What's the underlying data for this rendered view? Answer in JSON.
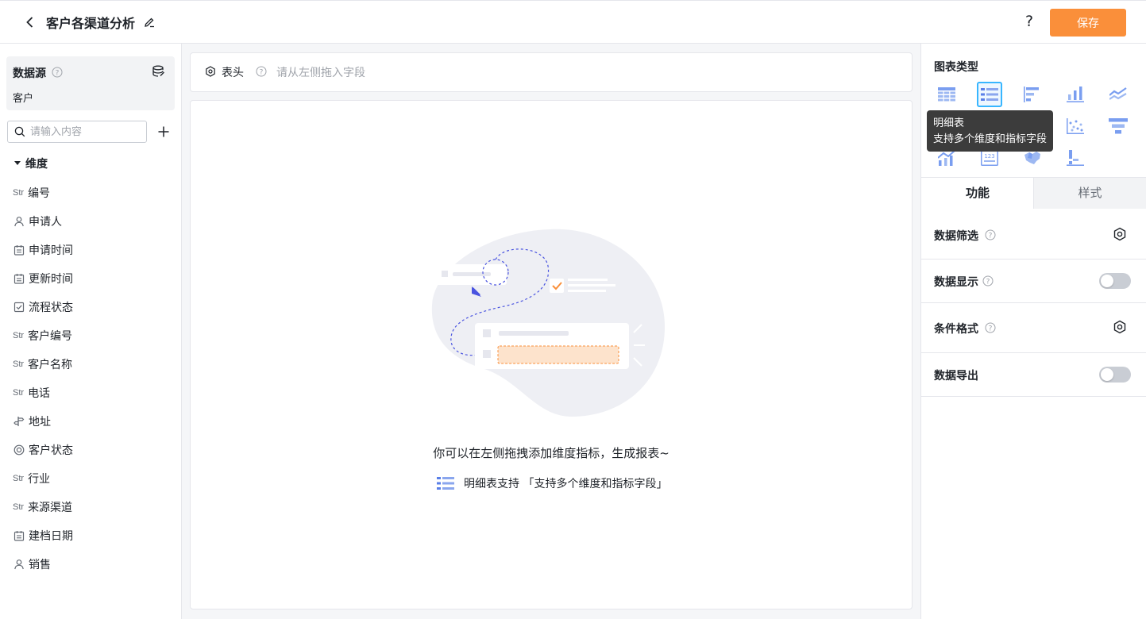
{
  "topbar": {
    "title": "客户各渠道分析",
    "help": "?",
    "save_label": "保存"
  },
  "left": {
    "datasource_label": "数据源",
    "datasource_value": "客户",
    "search_placeholder": "请输入内容",
    "dimension_header": "维度",
    "fields": [
      {
        "type": "text",
        "label": "编号"
      },
      {
        "type": "user",
        "label": "申请人"
      },
      {
        "type": "date",
        "label": "申请时间"
      },
      {
        "type": "date",
        "label": "更新时间"
      },
      {
        "type": "check",
        "label": "流程状态"
      },
      {
        "type": "text",
        "label": "客户编号"
      },
      {
        "type": "text",
        "label": "客户名称"
      },
      {
        "type": "text",
        "label": "电话"
      },
      {
        "type": "address",
        "label": "地址"
      },
      {
        "type": "radio",
        "label": "客户状态"
      },
      {
        "type": "text",
        "label": "行业"
      },
      {
        "type": "text",
        "label": "来源渠道"
      },
      {
        "type": "date",
        "label": "建档日期"
      },
      {
        "type": "user",
        "label": "销售"
      }
    ],
    "text_type_label": "Str"
  },
  "center": {
    "header_label": "表头",
    "header_placeholder": "请从左侧拖入字段",
    "empty_main": "你可以在左侧拖拽添加维度指标，生成报表~",
    "empty_sub": "明细表支持 「支持多个维度和指标字段」"
  },
  "right": {
    "chart_type_title": "图表类型",
    "tooltip_title": "明细表",
    "tooltip_desc": "支持多个维度和指标字段",
    "chart_type_names": [
      "table",
      "detail-table",
      "bar-horizontal",
      "bar-vertical",
      "line",
      "area",
      "pie",
      "donut",
      "scatter",
      "funnel",
      "combo",
      "number",
      "map",
      "waterfall"
    ],
    "tabs": {
      "function": "功能",
      "style": "样式"
    },
    "options": [
      {
        "label": "数据筛选",
        "control": "gear"
      },
      {
        "label": "数据显示",
        "control": "toggle",
        "on": false
      },
      {
        "label": "条件格式",
        "control": "gear"
      },
      {
        "label": "数据导出",
        "control": "toggle",
        "on": false
      }
    ]
  },
  "colors": {
    "accent": "#fa8f3a",
    "chart_icon_blue": "#7a9ef0",
    "selected_border": "#38b6ff"
  }
}
